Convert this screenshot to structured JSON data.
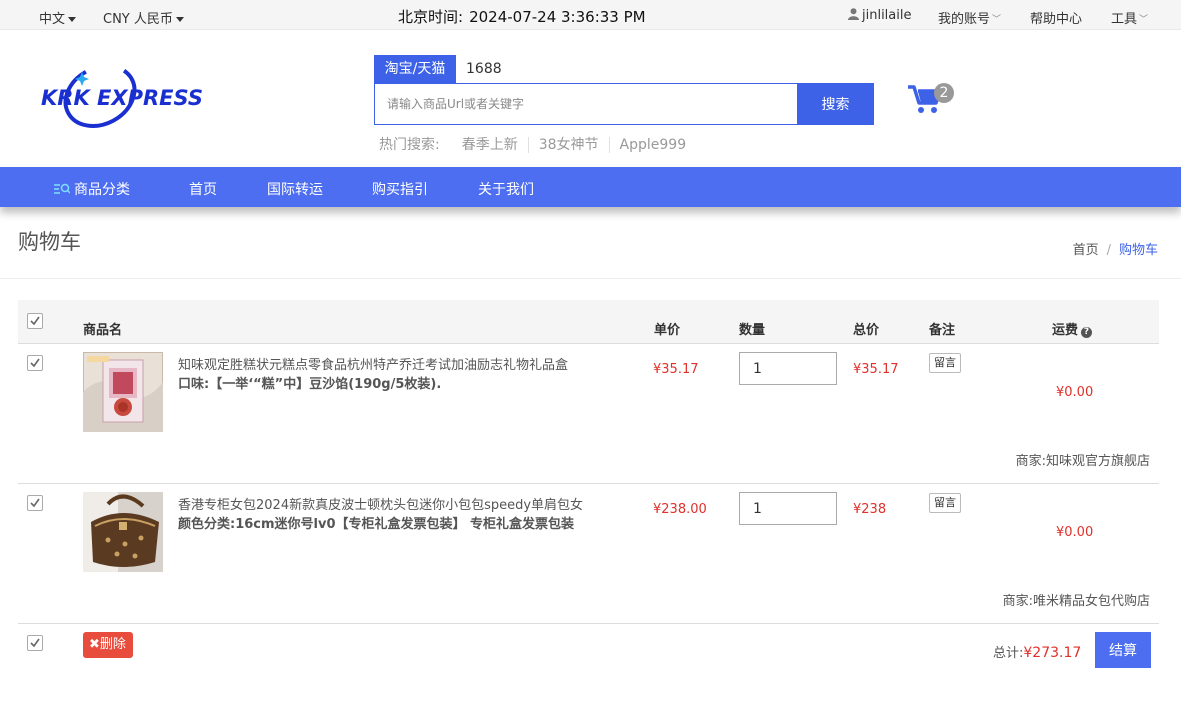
{
  "topbar": {
    "language": "中文",
    "currency": "CNY 人民币",
    "time_label": "北京时间:",
    "time_value": "2024-07-24 3:36:33 PM",
    "username": "jinlilaile",
    "my_account": "我的账号",
    "help_center": "帮助中心",
    "tools": "工具"
  },
  "header": {
    "logo_text": "KRK EXPRESS",
    "search_tabs": [
      "淘宝/天猫",
      "1688"
    ],
    "search_placeholder": "请输入商品Url或者关键字",
    "search_button": "搜索",
    "hot_label": "热门搜索:",
    "hot_keywords": [
      "春季上新",
      "38女神节",
      "Apple999"
    ],
    "cart_count": "2"
  },
  "nav": {
    "items": [
      "商品分类",
      "首页",
      "国际转运",
      "购买指引",
      "关于我们"
    ]
  },
  "page": {
    "title": "购物车",
    "breadcrumb_home": "首页",
    "breadcrumb_sep": "/",
    "breadcrumb_current": "购物车"
  },
  "table": {
    "headers": {
      "name": "商品名",
      "unit_price": "单价",
      "quantity": "数量",
      "total": "总价",
      "note": "备注",
      "shipping": "运费"
    },
    "rows": [
      {
        "name": "知味观定胜糕状元糕点零食品杭州特产乔迁考试加油励志礼物礼品盒",
        "attr": "口味:【一举‘“糕”中】豆沙馅(190g/5枚装).",
        "unit_price": "¥35.17",
        "quantity": "1",
        "total": "¥35.17",
        "note_button": "留言",
        "shipping": "¥0.00",
        "seller": "商家:知味观官方旗舰店",
        "checked": true
      },
      {
        "name": "香港专柜女包2024新款真皮波士顿枕头包迷你小包包speedy单肩包女",
        "attr": "颜色分类:16cm迷你号lv0【专柜礼盒发票包装】 专柜礼盒发票包装",
        "unit_price": "¥238.00",
        "quantity": "1",
        "total": "¥238",
        "note_button": "留言",
        "shipping": "¥0.00",
        "seller": "商家:唯米精品女包代购店",
        "checked": true
      }
    ]
  },
  "footer": {
    "delete_button": "删除",
    "total_label": "总计:",
    "total_value": "¥273.17",
    "checkout_button": "结算"
  },
  "colors": {
    "accent": "#3d62e8",
    "nav_bg": "#4d6ef0",
    "price_red": "#e0302a",
    "delete_red": "#e84c3d"
  }
}
